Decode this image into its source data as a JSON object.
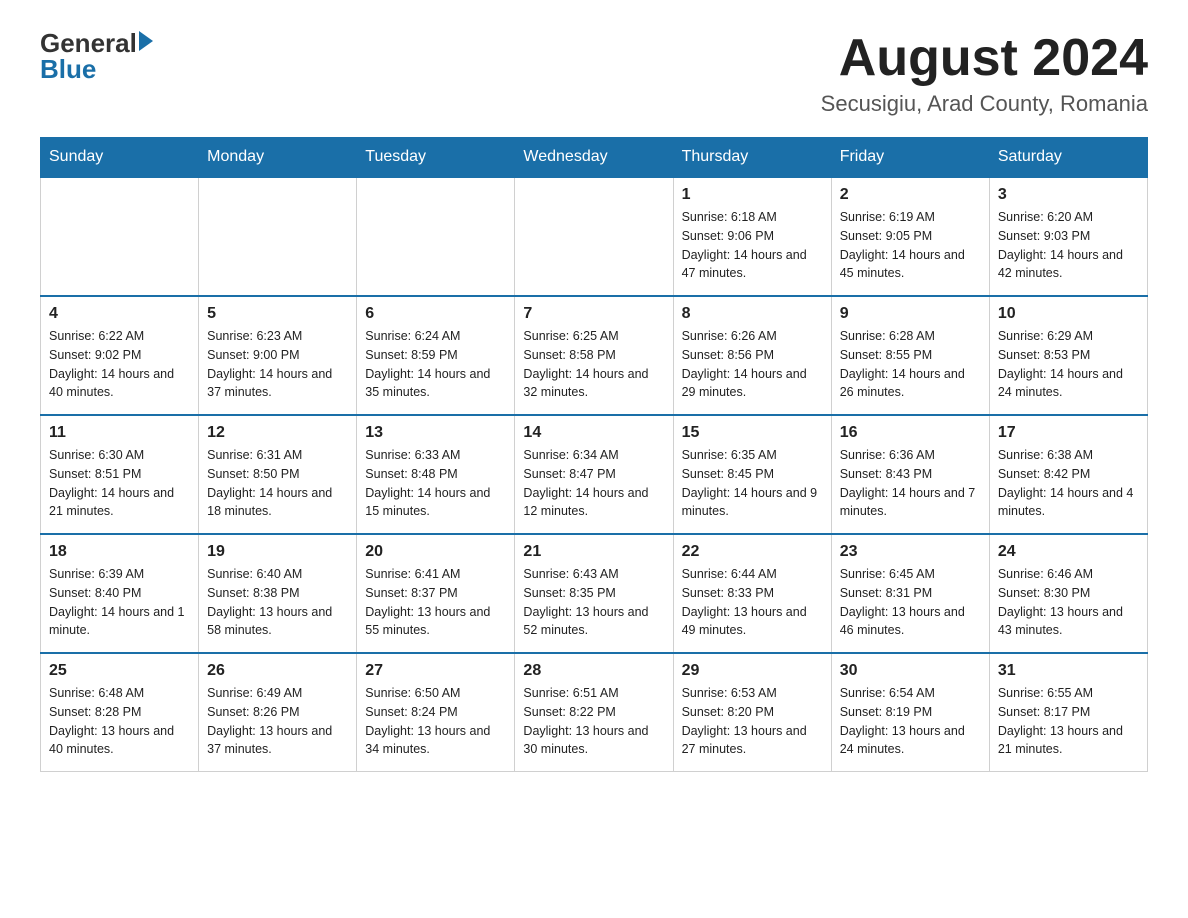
{
  "header": {
    "logo": {
      "general": "General",
      "blue": "Blue",
      "arrow": true
    },
    "title": "August 2024",
    "subtitle": "Secusigiu, Arad County, Romania"
  },
  "calendar": {
    "days_of_week": [
      "Sunday",
      "Monday",
      "Tuesday",
      "Wednesday",
      "Thursday",
      "Friday",
      "Saturday"
    ],
    "weeks": [
      [
        {
          "day": "",
          "detail": ""
        },
        {
          "day": "",
          "detail": ""
        },
        {
          "day": "",
          "detail": ""
        },
        {
          "day": "",
          "detail": ""
        },
        {
          "day": "1",
          "detail": "Sunrise: 6:18 AM\nSunset: 9:06 PM\nDaylight: 14 hours and 47 minutes."
        },
        {
          "day": "2",
          "detail": "Sunrise: 6:19 AM\nSunset: 9:05 PM\nDaylight: 14 hours and 45 minutes."
        },
        {
          "day": "3",
          "detail": "Sunrise: 6:20 AM\nSunset: 9:03 PM\nDaylight: 14 hours and 42 minutes."
        }
      ],
      [
        {
          "day": "4",
          "detail": "Sunrise: 6:22 AM\nSunset: 9:02 PM\nDaylight: 14 hours and 40 minutes."
        },
        {
          "day": "5",
          "detail": "Sunrise: 6:23 AM\nSunset: 9:00 PM\nDaylight: 14 hours and 37 minutes."
        },
        {
          "day": "6",
          "detail": "Sunrise: 6:24 AM\nSunset: 8:59 PM\nDaylight: 14 hours and 35 minutes."
        },
        {
          "day": "7",
          "detail": "Sunrise: 6:25 AM\nSunset: 8:58 PM\nDaylight: 14 hours and 32 minutes."
        },
        {
          "day": "8",
          "detail": "Sunrise: 6:26 AM\nSunset: 8:56 PM\nDaylight: 14 hours and 29 minutes."
        },
        {
          "day": "9",
          "detail": "Sunrise: 6:28 AM\nSunset: 8:55 PM\nDaylight: 14 hours and 26 minutes."
        },
        {
          "day": "10",
          "detail": "Sunrise: 6:29 AM\nSunset: 8:53 PM\nDaylight: 14 hours and 24 minutes."
        }
      ],
      [
        {
          "day": "11",
          "detail": "Sunrise: 6:30 AM\nSunset: 8:51 PM\nDaylight: 14 hours and 21 minutes."
        },
        {
          "day": "12",
          "detail": "Sunrise: 6:31 AM\nSunset: 8:50 PM\nDaylight: 14 hours and 18 minutes."
        },
        {
          "day": "13",
          "detail": "Sunrise: 6:33 AM\nSunset: 8:48 PM\nDaylight: 14 hours and 15 minutes."
        },
        {
          "day": "14",
          "detail": "Sunrise: 6:34 AM\nSunset: 8:47 PM\nDaylight: 14 hours and 12 minutes."
        },
        {
          "day": "15",
          "detail": "Sunrise: 6:35 AM\nSunset: 8:45 PM\nDaylight: 14 hours and 9 minutes."
        },
        {
          "day": "16",
          "detail": "Sunrise: 6:36 AM\nSunset: 8:43 PM\nDaylight: 14 hours and 7 minutes."
        },
        {
          "day": "17",
          "detail": "Sunrise: 6:38 AM\nSunset: 8:42 PM\nDaylight: 14 hours and 4 minutes."
        }
      ],
      [
        {
          "day": "18",
          "detail": "Sunrise: 6:39 AM\nSunset: 8:40 PM\nDaylight: 14 hours and 1 minute."
        },
        {
          "day": "19",
          "detail": "Sunrise: 6:40 AM\nSunset: 8:38 PM\nDaylight: 13 hours and 58 minutes."
        },
        {
          "day": "20",
          "detail": "Sunrise: 6:41 AM\nSunset: 8:37 PM\nDaylight: 13 hours and 55 minutes."
        },
        {
          "day": "21",
          "detail": "Sunrise: 6:43 AM\nSunset: 8:35 PM\nDaylight: 13 hours and 52 minutes."
        },
        {
          "day": "22",
          "detail": "Sunrise: 6:44 AM\nSunset: 8:33 PM\nDaylight: 13 hours and 49 minutes."
        },
        {
          "day": "23",
          "detail": "Sunrise: 6:45 AM\nSunset: 8:31 PM\nDaylight: 13 hours and 46 minutes."
        },
        {
          "day": "24",
          "detail": "Sunrise: 6:46 AM\nSunset: 8:30 PM\nDaylight: 13 hours and 43 minutes."
        }
      ],
      [
        {
          "day": "25",
          "detail": "Sunrise: 6:48 AM\nSunset: 8:28 PM\nDaylight: 13 hours and 40 minutes."
        },
        {
          "day": "26",
          "detail": "Sunrise: 6:49 AM\nSunset: 8:26 PM\nDaylight: 13 hours and 37 minutes."
        },
        {
          "day": "27",
          "detail": "Sunrise: 6:50 AM\nSunset: 8:24 PM\nDaylight: 13 hours and 34 minutes."
        },
        {
          "day": "28",
          "detail": "Sunrise: 6:51 AM\nSunset: 8:22 PM\nDaylight: 13 hours and 30 minutes."
        },
        {
          "day": "29",
          "detail": "Sunrise: 6:53 AM\nSunset: 8:20 PM\nDaylight: 13 hours and 27 minutes."
        },
        {
          "day": "30",
          "detail": "Sunrise: 6:54 AM\nSunset: 8:19 PM\nDaylight: 13 hours and 24 minutes."
        },
        {
          "day": "31",
          "detail": "Sunrise: 6:55 AM\nSunset: 8:17 PM\nDaylight: 13 hours and 21 minutes."
        }
      ]
    ]
  }
}
